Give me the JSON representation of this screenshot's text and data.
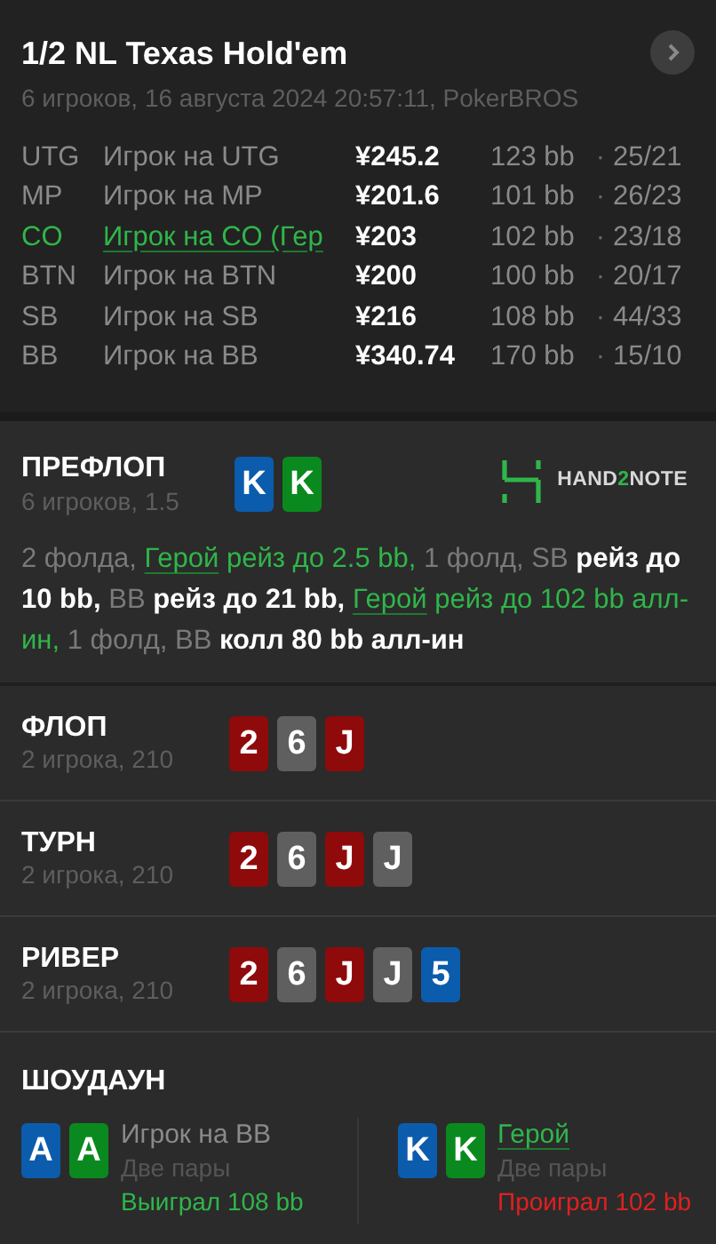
{
  "header": {
    "title": "1/2 NL Texas Hold'em",
    "subtitle": "6 игроков, 16 августа 2024 20:57:11, PokerBROS"
  },
  "players": [
    {
      "position": "UTG",
      "name": "Игрок на UTG",
      "hero": false,
      "stack": "¥245.2",
      "bb": "123 bb",
      "separator": "·",
      "stats": "25/21"
    },
    {
      "position": "MP",
      "name": "Игрок на MP",
      "hero": false,
      "stack": "¥201.6",
      "bb": "101 bb",
      "separator": "·",
      "stats": "26/23"
    },
    {
      "position": "CO",
      "name": "Игрок на CO (Гер",
      "hero": true,
      "stack": "¥203",
      "bb": "102 bb",
      "separator": "·",
      "stats": "23/18"
    },
    {
      "position": "BTN",
      "name": "Игрок на BTN",
      "hero": false,
      "stack": "¥200",
      "bb": "100 bb",
      "separator": "·",
      "stats": "20/17"
    },
    {
      "position": "SB",
      "name": "Игрок на SB",
      "hero": false,
      "stack": "¥216",
      "bb": "108 bb",
      "separator": "·",
      "stats": "44/33"
    },
    {
      "position": "BB",
      "name": "Игрок на BB",
      "hero": false,
      "stack": "¥340.74",
      "bb": "170 bb",
      "separator": "·",
      "stats": "15/10"
    }
  ],
  "preflop": {
    "title": "ПРЕФЛОП",
    "subtitle": "6 игроков, 1.5",
    "cards": [
      {
        "rank": "K",
        "color": "#0b5cad"
      },
      {
        "rank": "K",
        "color": "#0a8a1e"
      }
    ],
    "logo": [
      "HAND",
      "2",
      "NOTE"
    ],
    "actions": [
      {
        "kind": "muted",
        "text": "2 фолда, "
      },
      {
        "kind": "hero_link",
        "text": "Герой"
      },
      {
        "kind": "hero",
        "text": " рейз до 2.5 bb,"
      },
      {
        "kind": "muted",
        "text": " 1 фолд, SB"
      },
      {
        "kind": "action",
        "text": " рейз до 10 bb,"
      },
      {
        "kind": "muted",
        "text": " BB"
      },
      {
        "kind": "action",
        "text": " рейз до 21 bb, "
      },
      {
        "kind": "hero_link",
        "text": "Герой"
      },
      {
        "kind": "hero",
        "text": " рейз до 102 bb алл-ин,"
      },
      {
        "kind": "muted",
        "text": " 1 фолд, BB"
      },
      {
        "kind": "action",
        "text": " колл 80 bb алл-ин"
      }
    ]
  },
  "streets": [
    {
      "title": "ФЛОП",
      "subtitle": "2 игрока, 210",
      "cards": [
        {
          "rank": "2",
          "color": "#8f0a0a"
        },
        {
          "rank": "6",
          "color": "#5f5f5f"
        },
        {
          "rank": "J",
          "color": "#8f0a0a"
        }
      ]
    },
    {
      "title": "ТУРН",
      "subtitle": "2 игрока, 210",
      "cards": [
        {
          "rank": "2",
          "color": "#8f0a0a"
        },
        {
          "rank": "6",
          "color": "#5f5f5f"
        },
        {
          "rank": "J",
          "color": "#8f0a0a"
        },
        {
          "rank": "J",
          "color": "#5f5f5f"
        }
      ]
    },
    {
      "title": "РИВЕР",
      "subtitle": "2 игрока, 210",
      "cards": [
        {
          "rank": "2",
          "color": "#8f0a0a"
        },
        {
          "rank": "6",
          "color": "#5f5f5f"
        },
        {
          "rank": "J",
          "color": "#8f0a0a"
        },
        {
          "rank": "J",
          "color": "#5f5f5f"
        },
        {
          "rank": "5",
          "color": "#0b5cad"
        }
      ]
    }
  ],
  "showdown": {
    "title": "ШОУДАУН",
    "hands": [
      {
        "name": "Игрок на BB",
        "hero": false,
        "hand": "Две пары",
        "result": "Выиграл 108 bb",
        "won": true,
        "cards": [
          {
            "rank": "A",
            "color": "#0b5cad"
          },
          {
            "rank": "A",
            "color": "#0a8a1e"
          }
        ]
      },
      {
        "name": "Герой",
        "hero": true,
        "hand": "Две пары",
        "result": "Проиграл 102 bb",
        "won": false,
        "cards": [
          {
            "rank": "K",
            "color": "#0b5cad"
          },
          {
            "rank": "K",
            "color": "#0a8a1e"
          }
        ]
      }
    ]
  }
}
